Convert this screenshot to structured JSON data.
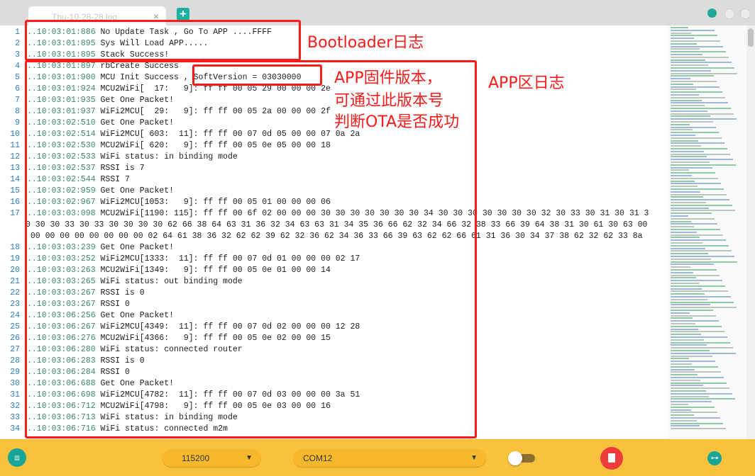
{
  "window": {
    "tab_title": "Thu-10-28-28.log",
    "tab_close": "×",
    "new_tab": "+"
  },
  "editor": {
    "lines": [
      {
        "n": "1",
        "ts": "..10:03:01:886",
        "text": " No Update Task , Go To APP ....FFFF"
      },
      {
        "n": "2",
        "ts": "..10:03:01:895",
        "text": " Sys Will Load APP....."
      },
      {
        "n": "3",
        "ts": "..10:03:01:895",
        "text": " Stack Success!"
      },
      {
        "n": "4",
        "ts": "..10:03:01:897",
        "text": " rbCreate Success"
      },
      {
        "n": "5",
        "ts": "..10:03:01:900",
        "text": " MCU Init Success , SoftVersion = 03030000"
      },
      {
        "n": "6",
        "ts": "..10:03:01:924",
        "text": " MCU2WiFi[  17:   9]: ff ff 00 05 29 00 00 00 2e"
      },
      {
        "n": "7",
        "ts": "..10:03:01:935",
        "text": " Get One Packet!"
      },
      {
        "n": "8",
        "ts": "..10:03:01:937",
        "text": " WiFi2MCU[  29:   9]: ff ff 00 05 2a 00 00 00 2f"
      },
      {
        "n": "9",
        "ts": "..10:03:02:510",
        "text": " Get One Packet!"
      },
      {
        "n": "10",
        "ts": "..10:03:02:514",
        "text": " WiFi2MCU[ 603:  11]: ff ff 00 07 0d 05 00 00 07 0a 2a"
      },
      {
        "n": "11",
        "ts": "..10:03:02:530",
        "text": " MCU2WiFi[ 620:   9]: ff ff 00 05 0e 05 00 00 18"
      },
      {
        "n": "12",
        "ts": "..10:03:02:533",
        "text": " WiFi status: in binding mode"
      },
      {
        "n": "13",
        "ts": "..10:03:02:537",
        "text": " RSSI is 7"
      },
      {
        "n": "14",
        "ts": "..10:03:02:544",
        "text": " RSSI 7"
      },
      {
        "n": "15",
        "ts": "..10:03:02:959",
        "text": " Get One Packet!"
      },
      {
        "n": "16",
        "ts": "..10:03:02:967",
        "text": " WiFi2MCU[1053:   9]: ff ff 00 05 01 00 00 00 06"
      },
      {
        "n": "17",
        "ts": "..10:03:03:098",
        "text": " MCU2WiFi[1190: 115]: ff ff 00 6f 02 00 00 00 30 30 30 30 30 30 30 34 30 30 30 30 30 30 30 32 30 33 30 31 30 31 3"
      },
      {
        "n": "",
        "ts": "",
        "text": "0 30 30 33 30 33 30 30 30 30 62 66 38 64 63 31 36 32 34 63 63 31 34 35 36 66 62 32 34 66 32 38 33 66 39 64 38 31 30 61 30 63 00"
      },
      {
        "n": "",
        "ts": "",
        "text": " 00 00 00 00 00 00 00 00 02 64 61 38 36 32 62 62 39 62 32 36 62 34 36 33 66 39 63 62 62 66 61 31 36 30 34 37 38 62 32 62 33 8a"
      },
      {
        "n": "18",
        "ts": "..10:03:03:239",
        "text": " Get One Packet!"
      },
      {
        "n": "19",
        "ts": "..10:03:03:252",
        "text": " WiFi2MCU[1333:  11]: ff ff 00 07 0d 01 00 00 00 02 17"
      },
      {
        "n": "20",
        "ts": "..10:03:03:263",
        "text": " MCU2WiFi[1349:   9]: ff ff 00 05 0e 01 00 00 14"
      },
      {
        "n": "21",
        "ts": "..10:03:03:265",
        "text": " WiFi status: out binding mode"
      },
      {
        "n": "22",
        "ts": "..10:03:03:267",
        "text": " RSSI is 0"
      },
      {
        "n": "23",
        "ts": "..10:03:03:267",
        "text": " RSSI 0"
      },
      {
        "n": "24",
        "ts": "..10:03:06:256",
        "text": " Get One Packet!"
      },
      {
        "n": "25",
        "ts": "..10:03:06:267",
        "text": " WiFi2MCU[4349:  11]: ff ff 00 07 0d 02 00 00 00 12 28"
      },
      {
        "n": "26",
        "ts": "..10:03:06:276",
        "text": " MCU2WiFi[4366:   9]: ff ff 00 05 0e 02 00 00 15"
      },
      {
        "n": "27",
        "ts": "..10:03:06:280",
        "text": " WiFi status: connected router"
      },
      {
        "n": "28",
        "ts": "..10:03:06:283",
        "text": " RSSI is 0"
      },
      {
        "n": "29",
        "ts": "..10:03:06:284",
        "text": " RSSI 0"
      },
      {
        "n": "30",
        "ts": "..10:03:06:688",
        "text": " Get One Packet!"
      },
      {
        "n": "31",
        "ts": "..10:03:06:698",
        "text": " WiFi2MCU[4782:  11]: ff ff 00 07 0d 03 00 00 00 3a 51"
      },
      {
        "n": "32",
        "ts": "..10:03:06:712",
        "text": " MCU2WiFi[4798:   9]: ff ff 00 05 0e 03 00 00 16"
      },
      {
        "n": "33",
        "ts": "..10:03:06:713",
        "text": " WiFi status: in binding mode"
      },
      {
        "n": "34",
        "ts": "..10:03:06:716",
        "text": " WiFi status: connected m2m"
      }
    ]
  },
  "annotations": {
    "bootloader_label": "Bootloader日志",
    "app_version_line1": "APP固件版本，",
    "app_version_line2": "可通过此版本号",
    "app_version_line3": "判断OTA是否成功",
    "app_area_label": "APP区日志"
  },
  "toolbar": {
    "baud_rate": "115200",
    "port": "COM12",
    "menu_icon": "≡",
    "link_icon": "⊶"
  },
  "colors": {
    "accent": "#16a596",
    "toolbar_bg": "#f9c23c",
    "annotation": "#ff1a1a",
    "stop": "#ee3b3b",
    "line_numbers": "#2b7fc4",
    "timestamps": "#3b8a6a"
  }
}
